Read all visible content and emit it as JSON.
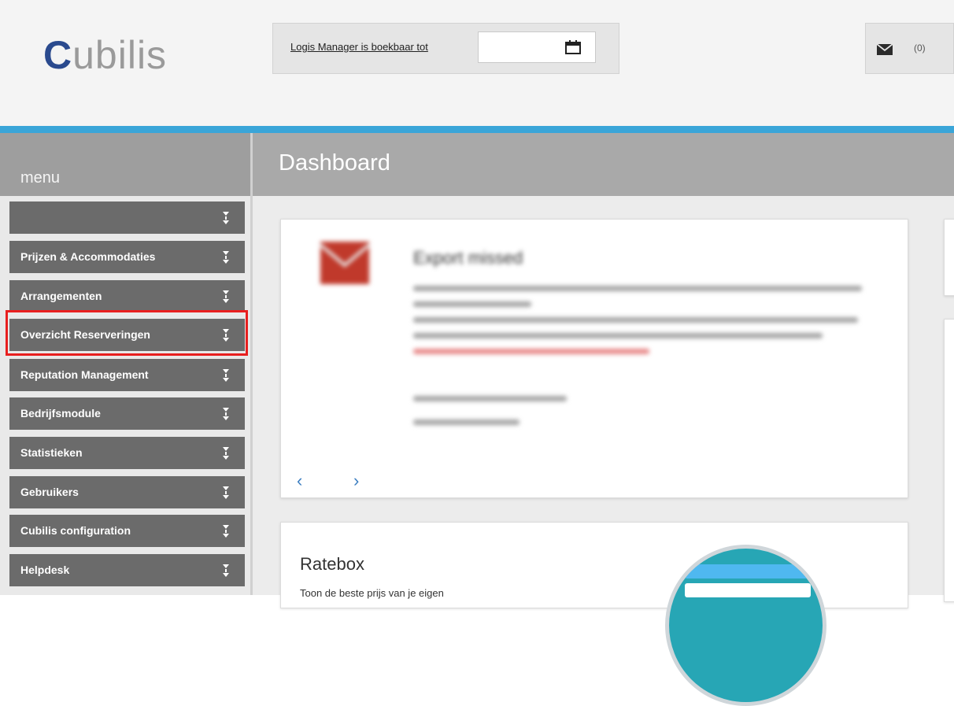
{
  "header": {
    "logo_initial": "C",
    "logo_rest": "ubilis",
    "booking_label": "Logis Manager is boekbaar tot",
    "date_value": "",
    "mail_count": "(0)"
  },
  "sidebar": {
    "title": "menu",
    "items": [
      {
        "label": ""
      },
      {
        "label": "Prijzen & Accommodaties"
      },
      {
        "label": "Arrangementen"
      },
      {
        "label": "Overzicht Reserveringen"
      },
      {
        "label": "Reputation Management"
      },
      {
        "label": "Bedrijfsmodule"
      },
      {
        "label": "Statistieken"
      },
      {
        "label": "Gebruikers"
      },
      {
        "label": "Cubilis configuration"
      },
      {
        "label": "Helpdesk"
      }
    ],
    "highlighted_item": "Overzicht Reserveringen"
  },
  "main": {
    "title": "Dashboard",
    "export_card": {
      "title": "Export missed",
      "prev_symbol": "‹",
      "next_symbol": "›"
    },
    "ratebox": {
      "title": "Ratebox",
      "text": "Toon de beste prijs van je eigen"
    }
  },
  "colors": {
    "accent_line": "#3aa5d8",
    "menu_item_bg": "#6b6b6b",
    "highlight_border": "#e81f1f",
    "nav_arrow": "#3d7fc1",
    "envelope": "#c0392b"
  }
}
